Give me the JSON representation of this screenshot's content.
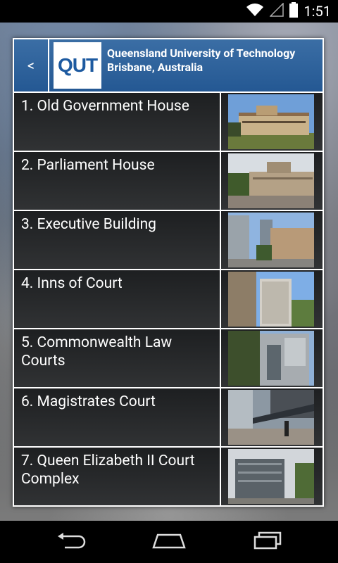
{
  "status": {
    "time": "1:51"
  },
  "header": {
    "back_label": "<",
    "logo_text": "QUT",
    "title": "Queensland University of Technology",
    "subtitle": "Brisbane, Australia"
  },
  "list": [
    {
      "label": "1. Old Government House"
    },
    {
      "label": "2. Parliament House"
    },
    {
      "label": "3. Executive Building"
    },
    {
      "label": "4. Inns of Court"
    },
    {
      "label": "5. Commonwealth Law Courts"
    },
    {
      "label": "6. Magistrates Court"
    },
    {
      "label": "7. Queen Elizabeth II Court Complex"
    }
  ],
  "colors": {
    "header_blue": "#2b609b"
  }
}
